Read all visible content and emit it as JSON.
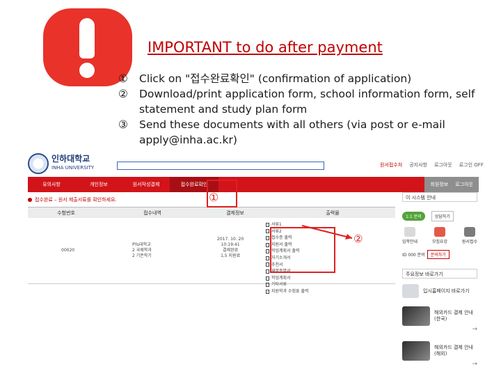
{
  "title": "IMPORTANT to do after payment",
  "steps": [
    {
      "num": "①",
      "text": "Click on \"접수완료확인\" (confirmation of application)"
    },
    {
      "num": "②",
      "text": "Download/print application form, school information form, self statement and study plan form"
    },
    {
      "num": "③",
      "text": "Send these documents with all others (via post or e-mail apply@inha.ac.kr)"
    }
  ],
  "site": {
    "logo_ko": "인하대학교",
    "logo_en": "INHA UNIVERSITY",
    "top_links": [
      "원서접수처",
      "공지사항",
      "로그아웃",
      "로그인 OFF"
    ],
    "nav": [
      "유의사항",
      "개인정보",
      "원서작성결제",
      "접수완료확인"
    ],
    "nav_active_index": 3,
    "nav_right": [
      "회원정보",
      "로그아웃"
    ],
    "notice": "접수완료 – 원서 제출서류를 확인하세요.",
    "table_headers": [
      "수험번호",
      "접수내역",
      "결제정보",
      "출력물"
    ],
    "row": {
      "id": "00020",
      "app_info": [
        "PYu대학교",
        "2 국제학과",
        "2 기존학기"
      ],
      "pay_info": [
        "2017. 10. 20",
        "10:19:41",
        "결제완료",
        "1,5 지원료"
      ],
      "docs": [
        "서류1",
        "서류2",
        "접수증 출력",
        "지원서 출력",
        "학업계획서 출력",
        "자기소개서",
        "추천서",
        "재학증명서",
        "학업계획서",
        "기타서류",
        "지원학과 수험표 출력"
      ]
    },
    "markers": {
      "one": "①",
      "two": "②"
    },
    "sidebar": {
      "header": "이 시스템 안내",
      "pill": "1:1 문의",
      "btn": "상담하기",
      "icons": [
        "입학안내",
        "모집요강",
        "원서접수"
      ],
      "inquiry_label": "ID 000 문의",
      "inquiry_btn": "문의하기",
      "header2": "주요정보 바로가기",
      "link": "입시홈페이지 바로가기",
      "card1": [
        "해외카드 결제 안내",
        "(한국)"
      ],
      "card2": [
        "해외카드 결제 안내",
        "(해외)"
      ]
    }
  }
}
